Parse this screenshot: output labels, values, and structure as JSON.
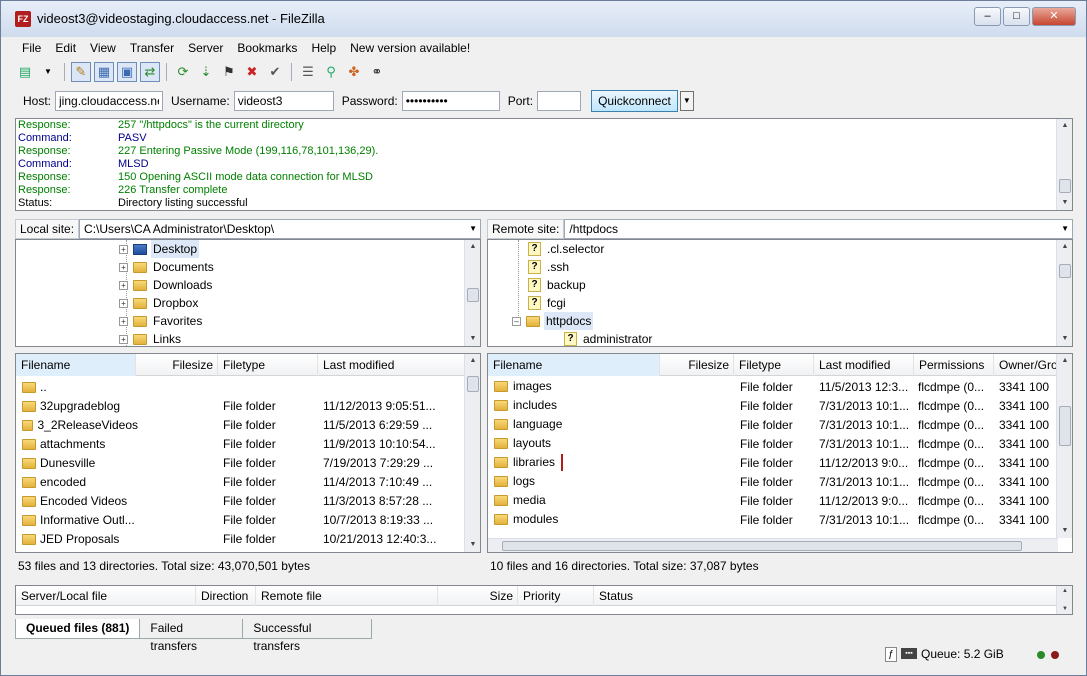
{
  "window": {
    "title": "videost3@videostaging.cloudaccess.net - FileZilla",
    "minimize": "–",
    "maximize": "□",
    "close": "✕"
  },
  "menu": [
    "File",
    "Edit",
    "View",
    "Transfer",
    "Server",
    "Bookmarks",
    "Help",
    "New version available!"
  ],
  "quickconnect": {
    "host_label": "Host:",
    "host_value": "jing.cloudaccess.net",
    "user_label": "Username:",
    "user_value": "videost3",
    "pass_label": "Password:",
    "pass_value": "••••••••••",
    "port_label": "Port:",
    "port_value": "",
    "button": "Quickconnect"
  },
  "log": [
    {
      "label": "Response:",
      "msg": "257 \"/httpdocs\" is the current directory",
      "kind": "resp"
    },
    {
      "label": "Command:",
      "msg": "PASV",
      "kind": "cmd"
    },
    {
      "label": "Response:",
      "msg": "227 Entering Passive Mode (199,116,78,101,136,29).",
      "kind": "resp"
    },
    {
      "label": "Command:",
      "msg": "MLSD",
      "kind": "cmd"
    },
    {
      "label": "Response:",
      "msg": "150 Opening ASCII mode data connection for MLSD",
      "kind": "resp"
    },
    {
      "label": "Response:",
      "msg": "226 Transfer complete",
      "kind": "resp"
    },
    {
      "label": "Status:",
      "msg": "Directory listing successful",
      "kind": "stat"
    }
  ],
  "local": {
    "site_label": "Local site:",
    "path": "C:\\Users\\CA Administrator\\Desktop\\",
    "tree": [
      {
        "name": "Desktop",
        "icon": "desktop",
        "selected": true
      },
      {
        "name": "Documents",
        "icon": "folder"
      },
      {
        "name": "Downloads",
        "icon": "folder"
      },
      {
        "name": "Dropbox",
        "icon": "folder"
      },
      {
        "name": "Favorites",
        "icon": "folder"
      },
      {
        "name": "Links",
        "icon": "folder"
      }
    ],
    "columns": [
      "Filename",
      "Filesize",
      "Filetype",
      "Last modified"
    ],
    "files": [
      {
        "name": "..",
        "type": "",
        "modified": ""
      },
      {
        "name": "32upgradeblog",
        "type": "File folder",
        "modified": "11/12/2013 9:05:51..."
      },
      {
        "name": "3_2ReleaseVideos",
        "type": "File folder",
        "modified": "11/5/2013 6:29:59 ..."
      },
      {
        "name": "attachments",
        "type": "File folder",
        "modified": "11/9/2013 10:10:54..."
      },
      {
        "name": "Dunesville",
        "type": "File folder",
        "modified": "7/19/2013 7:29:29 ..."
      },
      {
        "name": "encoded",
        "type": "File folder",
        "modified": "11/4/2013 7:10:49 ..."
      },
      {
        "name": "Encoded Videos",
        "type": "File folder",
        "modified": "11/3/2013 8:57:28 ..."
      },
      {
        "name": "Informative Outl...",
        "type": "File folder",
        "modified": "10/7/2013 8:19:33 ..."
      },
      {
        "name": "JED Proposals",
        "type": "File folder",
        "modified": "10/21/2013 12:40:3..."
      }
    ],
    "summary": "53 files and 13 directories. Total size: 43,070,501 bytes"
  },
  "remote": {
    "site_label": "Remote site:",
    "path": "/httpdocs",
    "tree": [
      {
        "name": ".cl.selector",
        "icon": "unknown"
      },
      {
        "name": ".ssh",
        "icon": "unknown"
      },
      {
        "name": "backup",
        "icon": "unknown"
      },
      {
        "name": "fcgi",
        "icon": "unknown"
      },
      {
        "name": "httpdocs",
        "icon": "folder",
        "selected": true
      },
      {
        "name": "administrator",
        "icon": "unknown"
      }
    ],
    "columns": [
      "Filename",
      "Filesize",
      "Filetype",
      "Last modified",
      "Permissions",
      "Owner/Gro"
    ],
    "files": [
      {
        "name": "images",
        "type": "File folder",
        "modified": "11/5/2013 12:3...",
        "perms": "flcdmpe (0...",
        "owner": "3341 100"
      },
      {
        "name": "includes",
        "type": "File folder",
        "modified": "7/31/2013 10:1...",
        "perms": "flcdmpe (0...",
        "owner": "3341 100"
      },
      {
        "name": "language",
        "type": "File folder",
        "modified": "7/31/2013 10:1...",
        "perms": "flcdmpe (0...",
        "owner": "3341 100"
      },
      {
        "name": "layouts",
        "type": "File folder",
        "modified": "7/31/2013 10:1...",
        "perms": "flcdmpe (0...",
        "owner": "3341 100"
      },
      {
        "name": "libraries",
        "type": "File folder",
        "modified": "11/12/2013 9:0...",
        "perms": "flcdmpe (0...",
        "owner": "3341 100",
        "highlight": true
      },
      {
        "name": "logs",
        "type": "File folder",
        "modified": "7/31/2013 10:1...",
        "perms": "flcdmpe (0...",
        "owner": "3341 100"
      },
      {
        "name": "media",
        "type": "File folder",
        "modified": "11/12/2013 9:0...",
        "perms": "flcdmpe (0...",
        "owner": "3341 100"
      },
      {
        "name": "modules",
        "type": "File folder",
        "modified": "7/31/2013 10:1...",
        "perms": "flcdmpe (0...",
        "owner": "3341 100"
      }
    ],
    "summary": "10 files and 16 directories. Total size: 37,087 bytes"
  },
  "queue": {
    "columns": [
      "Server/Local file",
      "Direction",
      "Remote file",
      "Size",
      "Priority",
      "Status"
    ],
    "tabs": [
      "Queued files (881)",
      "Failed transfers",
      "Successful transfers"
    ]
  },
  "statusbar": {
    "queue": "Queue: 5.2 GiB"
  },
  "colors": {
    "response": "#008000",
    "command": "#00008b",
    "highlight_box": "#b01c1c"
  }
}
